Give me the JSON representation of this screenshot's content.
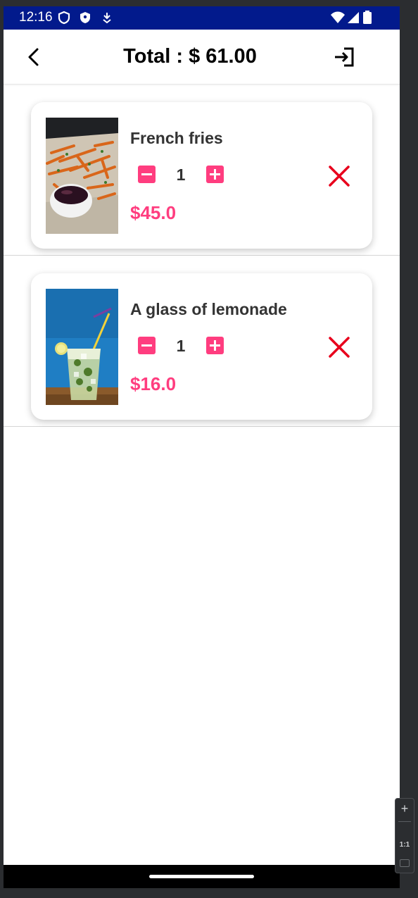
{
  "status_bar": {
    "time": "12:16",
    "background": "#021a8c",
    "left_icons": [
      "shield-outline-icon",
      "shield-filled-icon",
      "download-icon"
    ],
    "right_icons": [
      "wifi-icon",
      "signal-icon",
      "battery-icon"
    ]
  },
  "app_bar": {
    "title": "Total : $ 61.00",
    "back_icon": "arrow-back-icon",
    "logout_icon": "login-icon"
  },
  "cart": {
    "items": [
      {
        "name": "French fries",
        "quantity": "1",
        "price": "$45.0",
        "image": "french-fries-photo"
      },
      {
        "name": "A glass of lemonade",
        "quantity": "1",
        "price": "$16.0",
        "image": "lemonade-photo"
      }
    ]
  },
  "colors": {
    "accent": "#ff3d7f",
    "remove": "#e8001c",
    "text": "#333333"
  },
  "emulator_controls": {
    "zoom_in": "+",
    "ratio": "1:1"
  }
}
